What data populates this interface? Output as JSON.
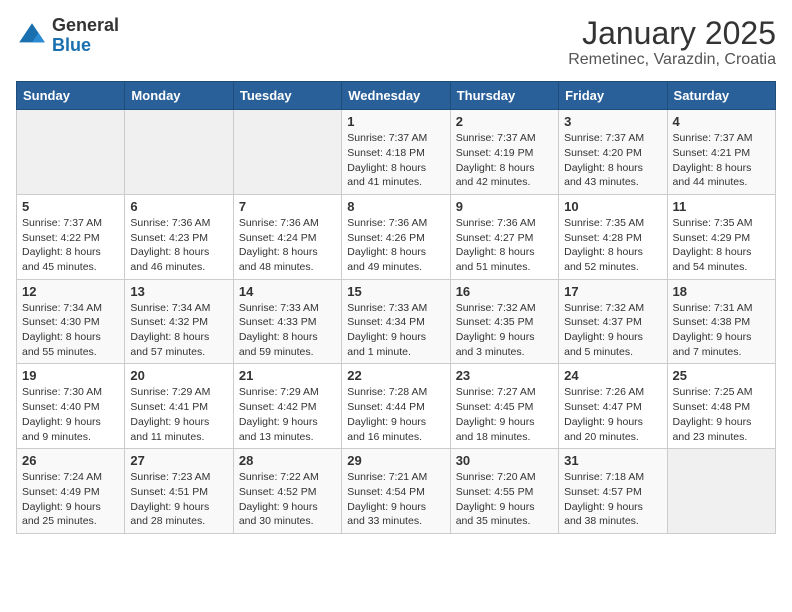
{
  "header": {
    "logo_general": "General",
    "logo_blue": "Blue",
    "title": "January 2025",
    "subtitle": "Remetinec, Varazdin, Croatia"
  },
  "days_of_week": [
    "Sunday",
    "Monday",
    "Tuesday",
    "Wednesday",
    "Thursday",
    "Friday",
    "Saturday"
  ],
  "weeks": [
    [
      {
        "day": "",
        "info": ""
      },
      {
        "day": "",
        "info": ""
      },
      {
        "day": "",
        "info": ""
      },
      {
        "day": "1",
        "info": "Sunrise: 7:37 AM\nSunset: 4:18 PM\nDaylight: 8 hours and 41 minutes."
      },
      {
        "day": "2",
        "info": "Sunrise: 7:37 AM\nSunset: 4:19 PM\nDaylight: 8 hours and 42 minutes."
      },
      {
        "day": "3",
        "info": "Sunrise: 7:37 AM\nSunset: 4:20 PM\nDaylight: 8 hours and 43 minutes."
      },
      {
        "day": "4",
        "info": "Sunrise: 7:37 AM\nSunset: 4:21 PM\nDaylight: 8 hours and 44 minutes."
      }
    ],
    [
      {
        "day": "5",
        "info": "Sunrise: 7:37 AM\nSunset: 4:22 PM\nDaylight: 8 hours and 45 minutes."
      },
      {
        "day": "6",
        "info": "Sunrise: 7:36 AM\nSunset: 4:23 PM\nDaylight: 8 hours and 46 minutes."
      },
      {
        "day": "7",
        "info": "Sunrise: 7:36 AM\nSunset: 4:24 PM\nDaylight: 8 hours and 48 minutes."
      },
      {
        "day": "8",
        "info": "Sunrise: 7:36 AM\nSunset: 4:26 PM\nDaylight: 8 hours and 49 minutes."
      },
      {
        "day": "9",
        "info": "Sunrise: 7:36 AM\nSunset: 4:27 PM\nDaylight: 8 hours and 51 minutes."
      },
      {
        "day": "10",
        "info": "Sunrise: 7:35 AM\nSunset: 4:28 PM\nDaylight: 8 hours and 52 minutes."
      },
      {
        "day": "11",
        "info": "Sunrise: 7:35 AM\nSunset: 4:29 PM\nDaylight: 8 hours and 54 minutes."
      }
    ],
    [
      {
        "day": "12",
        "info": "Sunrise: 7:34 AM\nSunset: 4:30 PM\nDaylight: 8 hours and 55 minutes."
      },
      {
        "day": "13",
        "info": "Sunrise: 7:34 AM\nSunset: 4:32 PM\nDaylight: 8 hours and 57 minutes."
      },
      {
        "day": "14",
        "info": "Sunrise: 7:33 AM\nSunset: 4:33 PM\nDaylight: 8 hours and 59 minutes."
      },
      {
        "day": "15",
        "info": "Sunrise: 7:33 AM\nSunset: 4:34 PM\nDaylight: 9 hours and 1 minute."
      },
      {
        "day": "16",
        "info": "Sunrise: 7:32 AM\nSunset: 4:35 PM\nDaylight: 9 hours and 3 minutes."
      },
      {
        "day": "17",
        "info": "Sunrise: 7:32 AM\nSunset: 4:37 PM\nDaylight: 9 hours and 5 minutes."
      },
      {
        "day": "18",
        "info": "Sunrise: 7:31 AM\nSunset: 4:38 PM\nDaylight: 9 hours and 7 minutes."
      }
    ],
    [
      {
        "day": "19",
        "info": "Sunrise: 7:30 AM\nSunset: 4:40 PM\nDaylight: 9 hours and 9 minutes."
      },
      {
        "day": "20",
        "info": "Sunrise: 7:29 AM\nSunset: 4:41 PM\nDaylight: 9 hours and 11 minutes."
      },
      {
        "day": "21",
        "info": "Sunrise: 7:29 AM\nSunset: 4:42 PM\nDaylight: 9 hours and 13 minutes."
      },
      {
        "day": "22",
        "info": "Sunrise: 7:28 AM\nSunset: 4:44 PM\nDaylight: 9 hours and 16 minutes."
      },
      {
        "day": "23",
        "info": "Sunrise: 7:27 AM\nSunset: 4:45 PM\nDaylight: 9 hours and 18 minutes."
      },
      {
        "day": "24",
        "info": "Sunrise: 7:26 AM\nSunset: 4:47 PM\nDaylight: 9 hours and 20 minutes."
      },
      {
        "day": "25",
        "info": "Sunrise: 7:25 AM\nSunset: 4:48 PM\nDaylight: 9 hours and 23 minutes."
      }
    ],
    [
      {
        "day": "26",
        "info": "Sunrise: 7:24 AM\nSunset: 4:49 PM\nDaylight: 9 hours and 25 minutes."
      },
      {
        "day": "27",
        "info": "Sunrise: 7:23 AM\nSunset: 4:51 PM\nDaylight: 9 hours and 28 minutes."
      },
      {
        "day": "28",
        "info": "Sunrise: 7:22 AM\nSunset: 4:52 PM\nDaylight: 9 hours and 30 minutes."
      },
      {
        "day": "29",
        "info": "Sunrise: 7:21 AM\nSunset: 4:54 PM\nDaylight: 9 hours and 33 minutes."
      },
      {
        "day": "30",
        "info": "Sunrise: 7:20 AM\nSunset: 4:55 PM\nDaylight: 9 hours and 35 minutes."
      },
      {
        "day": "31",
        "info": "Sunrise: 7:18 AM\nSunset: 4:57 PM\nDaylight: 9 hours and 38 minutes."
      },
      {
        "day": "",
        "info": ""
      }
    ]
  ]
}
